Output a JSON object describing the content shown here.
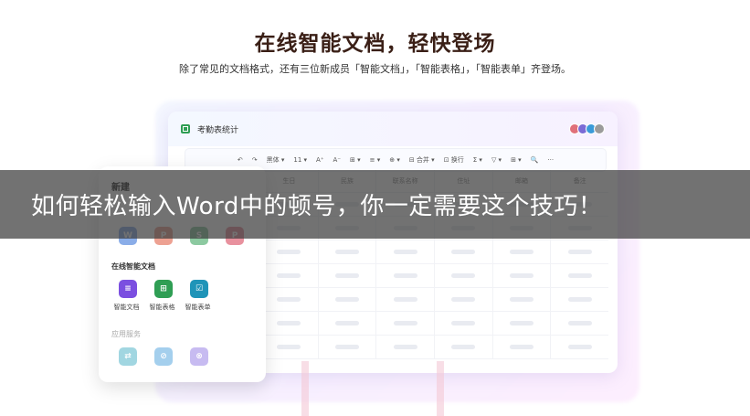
{
  "hero": {
    "title": "在线智能文档，轻快登场",
    "subtitle": "除了常见的文档格式，还有三位新成员「智能文档」，「智能表格」，「智能表单」齐登场。"
  },
  "sheet": {
    "title": "考勤表统计",
    "avatars": [
      "#e0707a",
      "#7b6bd6",
      "#3a9ad9",
      "#9b9b9b"
    ],
    "toolbar": [
      "↶",
      "↷",
      "黑体 ▾",
      "11 ▾",
      "A⁺",
      "A⁻",
      "⊞ ▾",
      "≡ ▾",
      "⊕ ▾",
      "⊟ 合并 ▾",
      "⊡ 换行",
      "Σ ▾",
      "▽ ▾",
      "⊞ ▾",
      "🔍",
      "···"
    ],
    "columns": [
      "生日",
      "民族",
      "联系名称",
      "住址",
      "邮箱",
      "备注"
    ],
    "row_count": 7
  },
  "panel": {
    "title": "新建",
    "section_online": "在线智能文档",
    "section_services": "应用服务",
    "basic_apps": [
      {
        "icon": "word-icon",
        "letter": "W",
        "color": "#2b6bd6"
      },
      {
        "icon": "ppt-icon",
        "letter": "P",
        "color": "#e0553a"
      },
      {
        "icon": "excel-icon",
        "letter": "S",
        "color": "#2f9e54"
      },
      {
        "icon": "pdf-icon",
        "letter": "P",
        "color": "#d6394f"
      }
    ],
    "smart_apps": [
      {
        "icon": "smart-doc-icon",
        "label": "智能文档",
        "color": "#7b4fe0",
        "glyph": "≡"
      },
      {
        "icon": "smart-sheet-icon",
        "label": "智能表格",
        "color": "#2f9e54",
        "glyph": "⊞"
      },
      {
        "icon": "smart-form-icon",
        "label": "智能表单",
        "color": "#1f94b8",
        "glyph": "☑"
      }
    ],
    "service_apps": [
      {
        "icon": "service-flow-icon",
        "color": "#55b6c9",
        "glyph": "⇄"
      },
      {
        "icon": "service-link-icon",
        "color": "#5aa8e0",
        "glyph": "⊘"
      },
      {
        "icon": "service-form-icon",
        "color": "#9b84e6",
        "glyph": "⊗"
      }
    ]
  },
  "overlay": {
    "caption": "如何轻松输入Word中的顿号，你一定需要这个技巧！"
  }
}
